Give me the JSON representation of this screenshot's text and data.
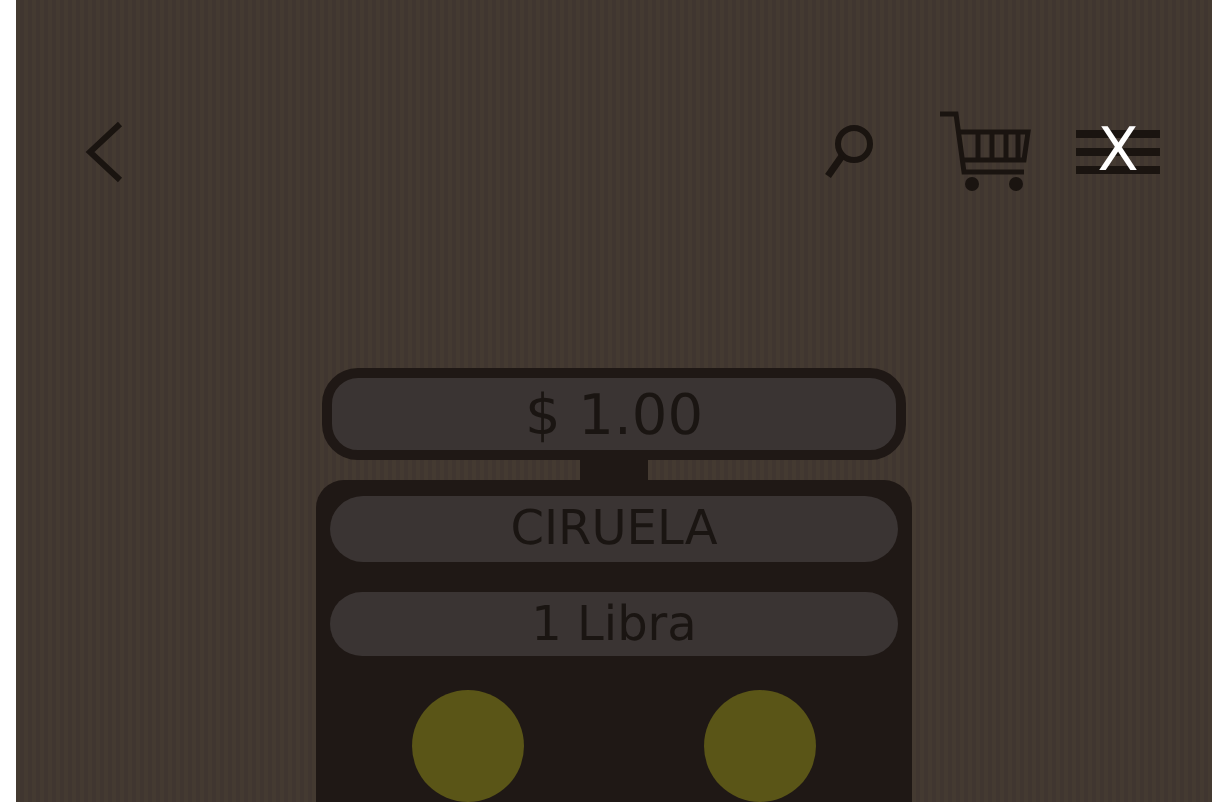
{
  "header": {
    "close": "X"
  },
  "price": "$ 1.00",
  "product": "CIRUELA",
  "quantity": "1 Libra"
}
